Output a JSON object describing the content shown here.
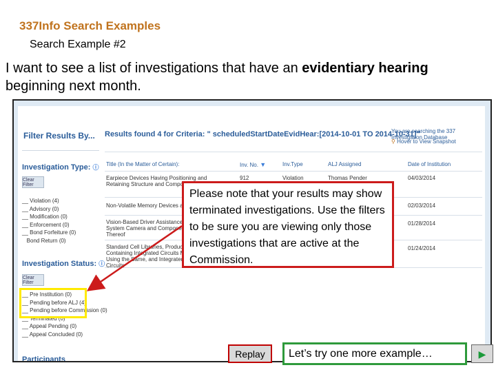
{
  "brand": "337Info Search Examples",
  "subhead": "Search Example #2",
  "intro": {
    "before": "I want to see a list of investigations that have an ",
    "bold": "evidentiary hearing",
    "after": " beginning next month."
  },
  "screenshot": {
    "filter_title": "Filter Results By...",
    "results_title": "Results found 4 for Criteria: \" scheduledStartDateEvidHear:[2014-10-01 TO 2014-10-31]\"",
    "db_note": "You are searching the 337 Investigation Database",
    "snapshot_link": "Hover to View Snapshot",
    "investigation_type": {
      "title": "Investigation Type:",
      "clear": "Clear Filter",
      "items": [
        "Violation (4)",
        "Advisory (0)",
        "Modification (0)",
        "Enforcement (0)",
        "Bond Forfeiture (0)",
        "Bond Return (0)"
      ]
    },
    "investigation_status": {
      "title": "Investigation Status:",
      "clear": "Clear Filter",
      "items": [
        "Pre Institution (0)",
        "Pending before ALJ (4)",
        "Pending before Commission (0)",
        "Terminated (0)",
        "Appeal Pending (0)",
        "Appeal Concluded (0)"
      ]
    },
    "participants_title": "Participants",
    "columns": [
      "Title (In the Matter of Certain):",
      "Inv. No.",
      "Inv.Type",
      "ALJ Assigned",
      "Date of Institution"
    ],
    "rows": [
      {
        "title": "Earpiece Devices Having Positioning and Retaining Structure and Components Thereof",
        "inv": "912",
        "type": "Violation",
        "alj": "Thomas Pender",
        "date": "04/03/2014"
      },
      {
        "title": "Non-Volatile Memory Devices and Products C",
        "inv": "",
        "type": "",
        "alj": "",
        "date": "02/03/2014"
      },
      {
        "title": "Vision-Based Driver Assistance System Camera and Components Thereof",
        "inv": "",
        "type": "",
        "alj": "",
        "date": "01/28/2014"
      },
      {
        "title": "Standard Cell Libraries, Products Containing Integrated Circuits Made Using the Same, and Integrated Circuits",
        "inv": "",
        "type": "",
        "alj": "",
        "date": "01/24/2014"
      }
    ]
  },
  "note": "Please note that your results may show terminated investigations. Use the filters to be sure you are viewing only those investigations that are active at the Commission.",
  "replay_label": "Replay",
  "next_label": "Let’s try one more example…",
  "colors": {
    "brand": "#c0731e",
    "accent_blue": "#2a5c99",
    "red": "#cc1b1b",
    "green": "#2e9a3b",
    "yellow": "#ffea00"
  }
}
